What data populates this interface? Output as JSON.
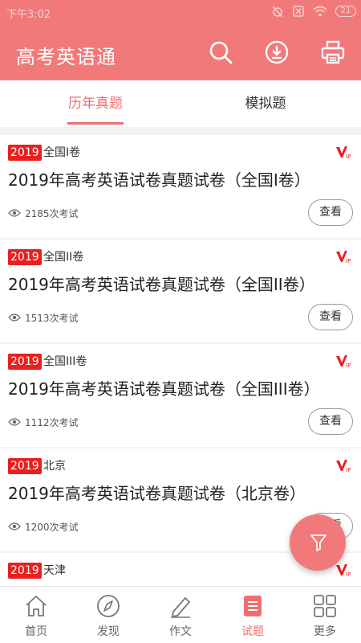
{
  "status_bar": {
    "time": "下午3:02",
    "battery": "21"
  },
  "app_bar": {
    "title": "高考英语通"
  },
  "tabs": [
    {
      "label": "历年真题"
    },
    {
      "label": "模拟题"
    }
  ],
  "papers": [
    {
      "year": "2019",
      "type": "全国I卷",
      "title": "2019年高考英语试卷真题试卷（全国I卷）",
      "count": "2185次考试",
      "button": "查看"
    },
    {
      "year": "2019",
      "type": "全国II卷",
      "title": "2019年高考英语试卷真题试卷（全国II卷）",
      "count": "1513次考试",
      "button": "查看"
    },
    {
      "year": "2019",
      "type": "全国III卷",
      "title": "2019年高考英语试卷真题试卷（全国III卷）",
      "count": "1112次考试",
      "button": "查看"
    },
    {
      "year": "2019",
      "type": "北京",
      "title": "2019年高考英语试卷真题试卷（北京卷）",
      "count": "1200次考试",
      "button": "查看"
    },
    {
      "year": "2019",
      "type": "天津",
      "title": "",
      "count": "",
      "button": ""
    }
  ],
  "bottom_nav": [
    {
      "label": "首页"
    },
    {
      "label": "发现"
    },
    {
      "label": "作文"
    },
    {
      "label": "试题"
    },
    {
      "label": "更多"
    }
  ],
  "colors": {
    "brand": "#f2797a",
    "accent": "#ef6f70",
    "badge": "#e8201f"
  }
}
